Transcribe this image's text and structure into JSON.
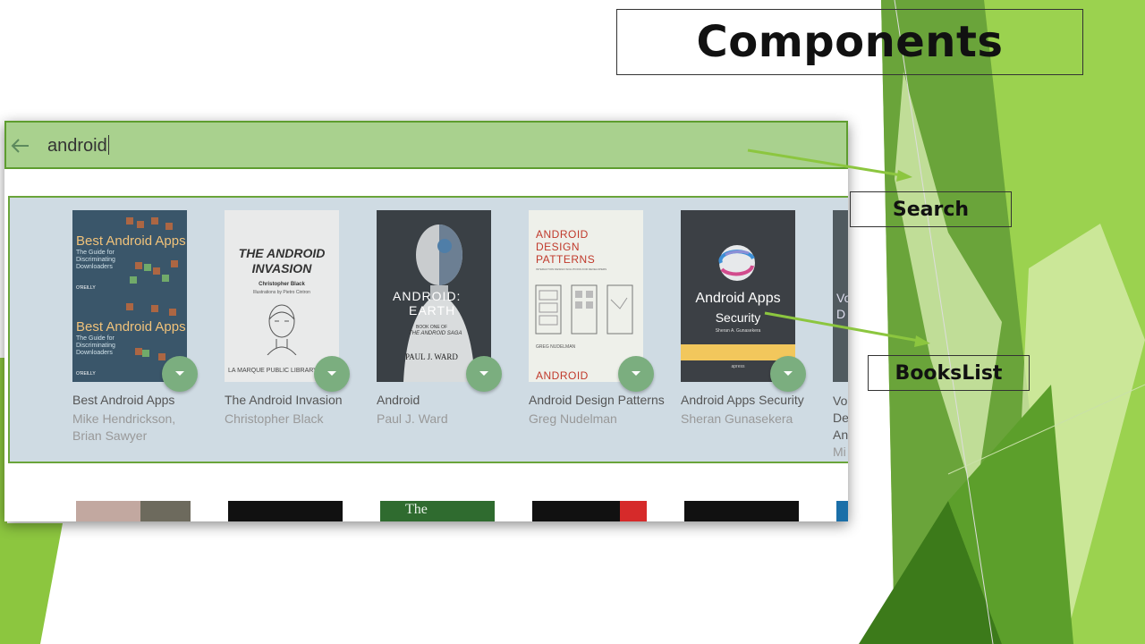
{
  "slide": {
    "title": "Components",
    "labels": {
      "search": "Search",
      "books_list": "BooksList"
    }
  },
  "app": {
    "search": {
      "value": "android"
    },
    "books": [
      {
        "title": "Best Android Apps",
        "author": "Mike Hendrickson, Brian Sawyer",
        "cover_text": [
          "Best Android Apps",
          "The Guide for Discriminating Downloaders",
          "O'REILLY"
        ]
      },
      {
        "title": "The Android Invasion",
        "author": "Christopher Black",
        "cover_text": [
          "THE ANDROID",
          "INVASION",
          "Christopher Black",
          "Illustrations by Pietro Cintron",
          "LA MARQUE PUBLIC LIBRARY"
        ]
      },
      {
        "title": "Android",
        "author": "Paul J. Ward",
        "cover_text": [
          "ANDROID:",
          "EARTH",
          "BOOK ONE OF",
          "THE ANDROID SAGA",
          "PAUL J. WARD"
        ]
      },
      {
        "title": "Android Design Patterns",
        "author": "Greg Nudelman",
        "cover_text": [
          "ANDROID",
          "DESIGN",
          "PATTERNS",
          "INTERACTION DESIGN SOLUTIONS FOR DEVELOPERS",
          "GREG NUDELMAN",
          "ANDROID"
        ]
      },
      {
        "title": "Android Apps Security",
        "author": "Sheran Gunasekera",
        "cover_text": [
          "Android Apps",
          "Security",
          "Sheran A. Gunasekera",
          "apress"
        ]
      },
      {
        "title": "Vo De An",
        "author": "Mi Zo"
      }
    ]
  },
  "colors": {
    "slide_green": "#8cc63f",
    "search_bar": "#a9d18e",
    "panel_border": "#6aa43a",
    "fab": "#7bae7f"
  }
}
